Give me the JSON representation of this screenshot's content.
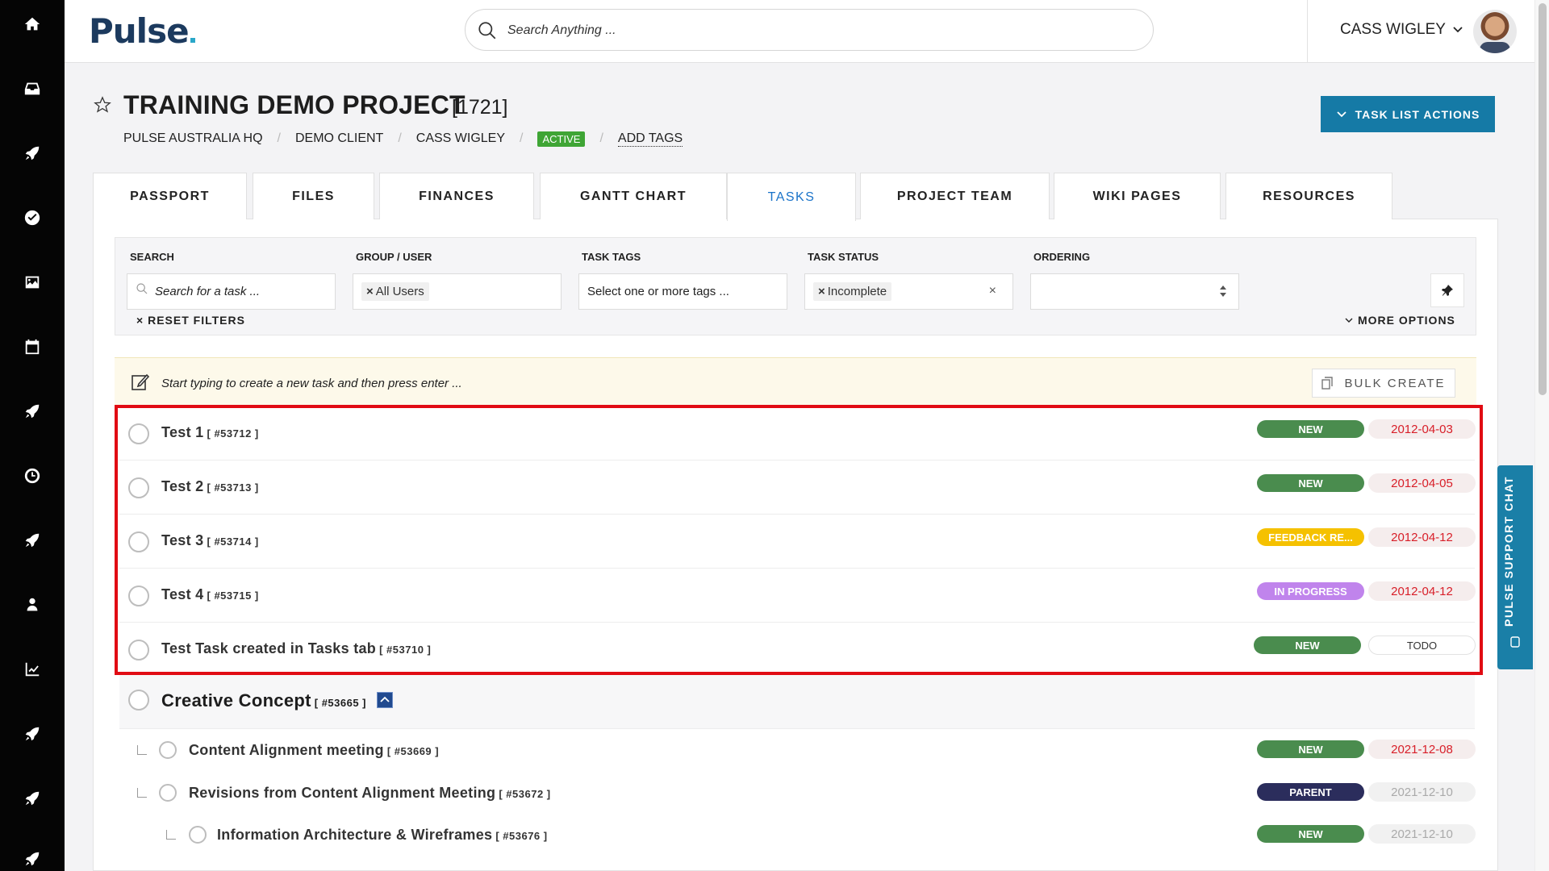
{
  "app": {
    "logo": "Pulse",
    "search_placeholder": "Search Anything ...",
    "user_name": "CASS WIGLEY"
  },
  "project": {
    "title": "TRAINING DEMO PROJECT",
    "id": "[1721]",
    "breadcrumb": [
      "PULSE AUSTRALIA HQ",
      "DEMO CLIENT",
      "CASS WIGLEY"
    ],
    "status": "ACTIVE",
    "add_tags": "ADD TAGS",
    "task_list_actions": "TASK LIST ACTIONS"
  },
  "tabs": [
    "PASSPORT",
    "FILES",
    "FINANCES",
    "GANTT CHART",
    "TASKS",
    "PROJECT TEAM",
    "WIKI PAGES",
    "RESOURCES"
  ],
  "active_tab": "TASKS",
  "filters": {
    "search": {
      "label": "SEARCH",
      "placeholder": "Search for a task ..."
    },
    "group_user": {
      "label": "GROUP / USER",
      "chip": "All Users"
    },
    "task_tags": {
      "label": "TASK TAGS",
      "placeholder": "Select one or more tags ..."
    },
    "task_status": {
      "label": "TASK STATUS",
      "chip": "Incomplete"
    },
    "ordering": {
      "label": "ORDERING",
      "value": ""
    },
    "reset": "RESET FILTERS",
    "more_options": "MORE OPTIONS"
  },
  "quick_create": {
    "placeholder": "Start typing to create a new task and then press enter ...",
    "bulk_create": "BULK CREATE"
  },
  "tasks": [
    {
      "name": "Test 1",
      "id": "[ #53712 ]",
      "status": "NEW",
      "status_color": "#4a8c4e",
      "date": "2012-04-03"
    },
    {
      "name": "Test 2",
      "id": "[ #53713 ]",
      "status": "NEW",
      "status_color": "#4a8c4e",
      "date": "2012-04-05"
    },
    {
      "name": "Test 3",
      "id": "[ #53714 ]",
      "status": "FEEDBACK RE...",
      "status_color": "#f5c100",
      "date": "2012-04-12"
    },
    {
      "name": "Test 4",
      "id": "[ #53715 ]",
      "status": "IN PROGRESS",
      "status_color": "#c084ec",
      "date": "2012-04-12"
    },
    {
      "name": "Test Task created in Tasks tab",
      "id": "[ #53710 ]",
      "status": "NEW",
      "status_color": "#4a8c4e",
      "date": "TODO"
    }
  ],
  "group": {
    "name": "Creative Concept",
    "id": "[ #53665 ]"
  },
  "subtasks": [
    {
      "name": "Content Alignment meeting",
      "id": "[ #53669 ]",
      "status": "NEW",
      "status_color": "#4a8c4e",
      "date": "2021-12-08",
      "date_style": "red"
    },
    {
      "name": "Revisions from Content Alignment Meeting",
      "id": "[ #53672 ]",
      "status": "PARENT",
      "status_color": "#2b2d5c",
      "date": "2021-12-10",
      "date_style": "grey"
    },
    {
      "name": "Information Architecture & Wireframes",
      "id": "[ #53676 ]",
      "status": "NEW",
      "status_color": "#4a8c4e",
      "date": "2021-12-10",
      "date_style": "grey"
    }
  ],
  "support_chat": "PULSE SUPPORT CHAT",
  "colors": {
    "accent": "#157aa6",
    "highlight": "#e10b13",
    "active_badge": "#3fa535"
  },
  "rail_icons": [
    "home-icon",
    "inbox-icon",
    "rocket-icon",
    "check-circle-icon",
    "image-icon",
    "calendar-icon",
    "rocket-icon",
    "clock-icon",
    "rocket-icon",
    "user-icon",
    "chart-icon",
    "rocket-icon",
    "rocket-icon",
    "rocket-icon"
  ]
}
